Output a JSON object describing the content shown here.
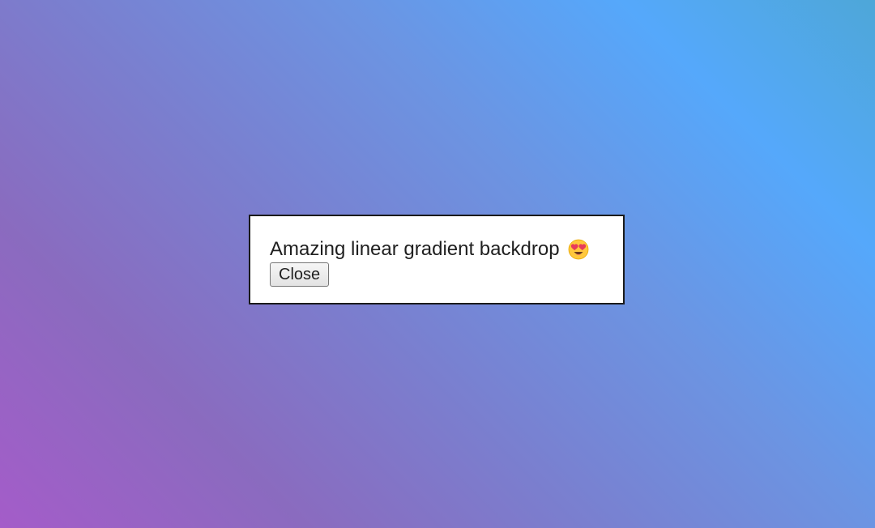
{
  "dialog": {
    "message": "Amazing linear gradient backdrop",
    "emoji_icon": "heart-eyes-emoji-icon",
    "close_label": "Close"
  },
  "backdrop": {
    "style": "linear-gradient",
    "colors": [
      "#a45cc9",
      "#8a6bbf",
      "#7a7fcf",
      "#6c94e2",
      "#55a8fb",
      "#4ea7d8"
    ]
  }
}
